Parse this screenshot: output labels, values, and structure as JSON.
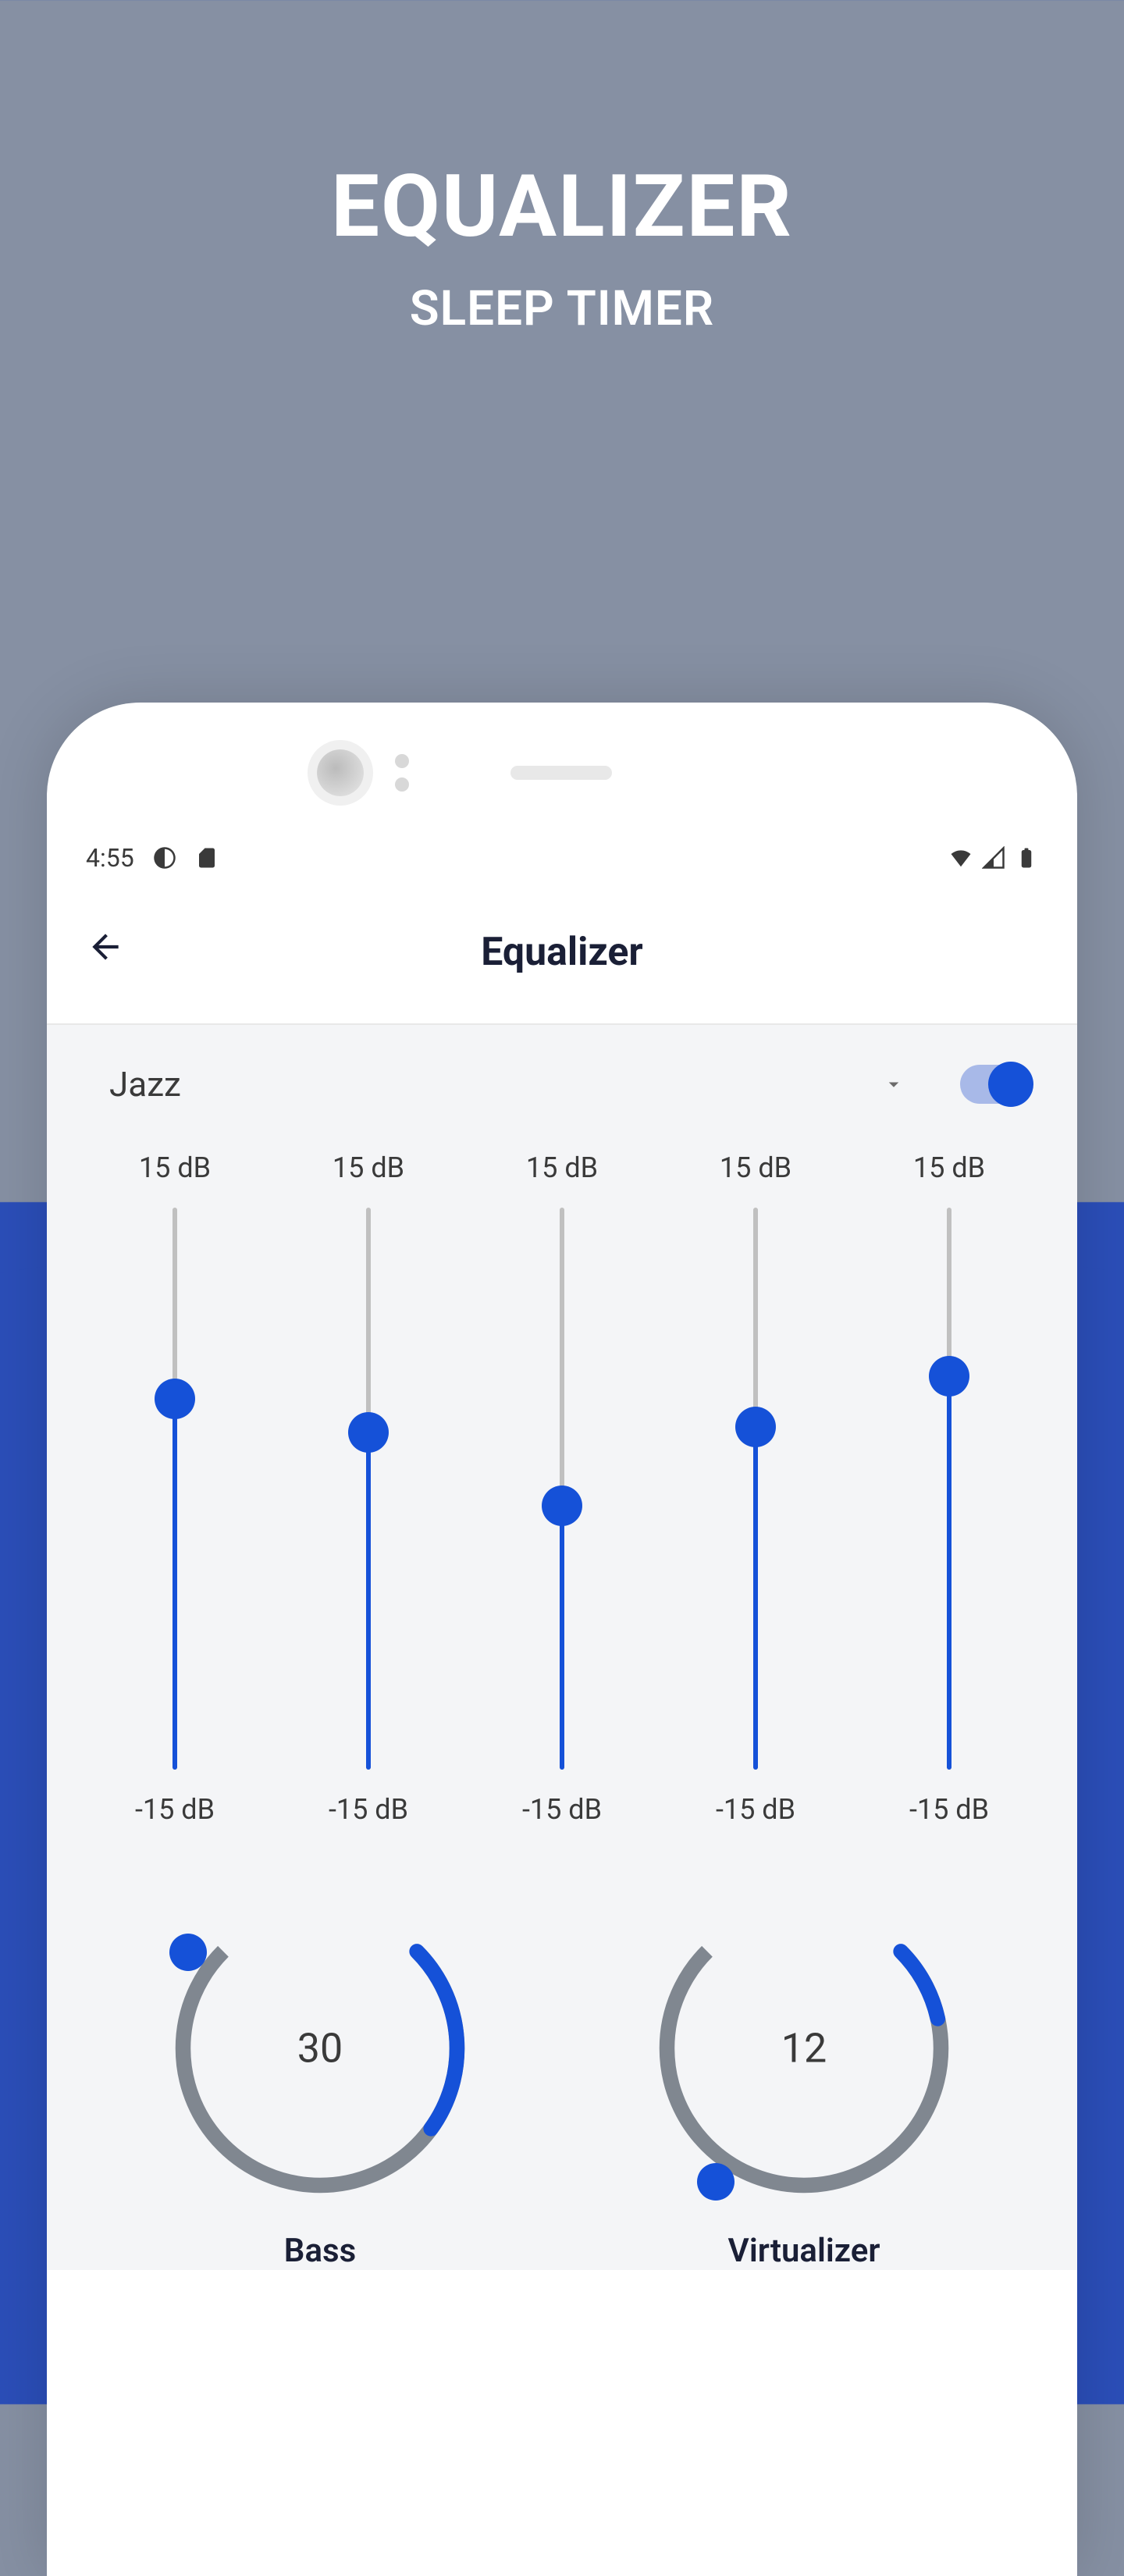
{
  "promo": {
    "title": "EQUALIZER",
    "subtitle": "SLEEP TIMER"
  },
  "status": {
    "time": "4:55"
  },
  "header": {
    "title": "Equalizer"
  },
  "preset": {
    "selected": "Jazz",
    "toggle_on": true
  },
  "eq": {
    "max_label": "15 dB",
    "min_label": "-15 dB",
    "bands": [
      {
        "percent": 66
      },
      {
        "percent": 60
      },
      {
        "percent": 47
      },
      {
        "percent": 61
      },
      {
        "percent": 70
      }
    ]
  },
  "knobs": {
    "bass": {
      "value": "30",
      "label": "Bass",
      "percent": 30
    },
    "virtualizer": {
      "value": "12",
      "label": "Virtualizer",
      "percent": 12
    }
  }
}
